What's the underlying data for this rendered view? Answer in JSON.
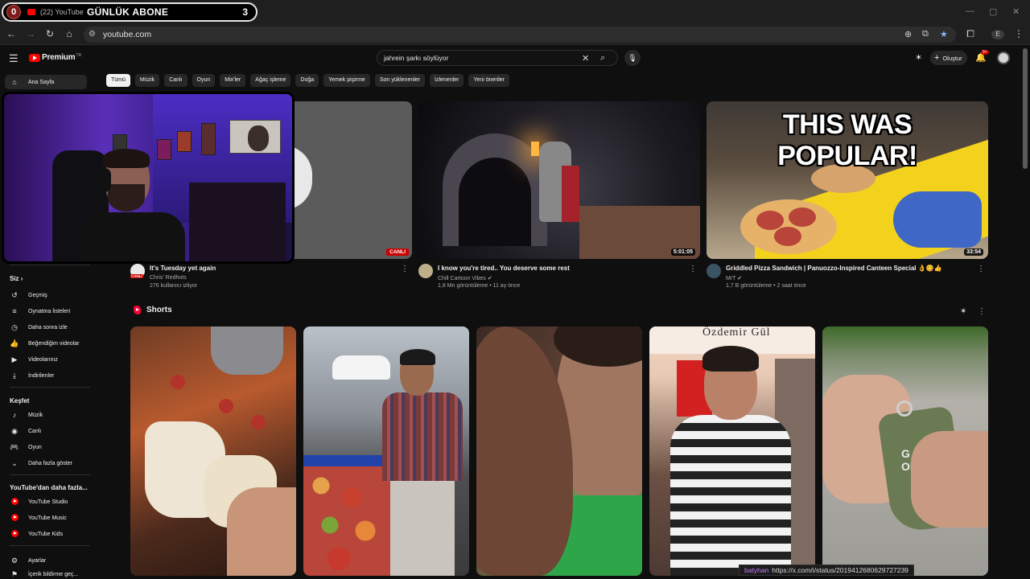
{
  "browser": {
    "tab": {
      "left_count": "0",
      "title": "(22) YouTube",
      "overlay_text": "GÜNLÜK ABONE",
      "right_count": "3"
    },
    "url": "youtube.com"
  },
  "header": {
    "logo_text": "Premium",
    "logo_region": "TR",
    "search_query": "jahrein şarkı söylüyor",
    "create_label": "Oluştur",
    "notifications_badge": "9+"
  },
  "chips": [
    "Tümü",
    "Müzik",
    "Canlı",
    "Oyun",
    "Mix'ler",
    "Ağaç işleme",
    "Doğa",
    "Yemek pişirme",
    "Son yüklenenler",
    "İzlenenler",
    "Yeni öneriler"
  ],
  "sidebar": {
    "home": "Ana Sayfa",
    "you_heading": "Siz",
    "you_items": [
      "Geçmiş",
      "Oynatma listeleri",
      "Daha sonra izle",
      "Beğendiğim videolar",
      "Videolarınız",
      "İndirilenler"
    ],
    "explore_heading": "Keşfet",
    "explore_items": [
      "Müzik",
      "Canlı",
      "Oyun",
      "Daha fazla göster"
    ],
    "more_heading": "YouTube'dan daha fazla...",
    "more_items": [
      "YouTube Studio",
      "YouTube Music",
      "YouTube Kids"
    ],
    "settings": "Ayarlar",
    "history_report": "İçerik bildirme geç..."
  },
  "videos": [
    {
      "title": "It's Tuesday yet again",
      "channel": "Chris' Redhots",
      "stats": "276 kullanıcı izliyor",
      "badge": "CANLI",
      "avatar_badge": "CANLI"
    },
    {
      "title": "I know you're tired.. You deserve some rest",
      "channel": "Chill Cartoon Vibes",
      "stats": "1,8 Mn görüntüleme • 11 ay önce",
      "duration": "5:01:05"
    },
    {
      "title": "Griddled Pizza Sandwich | Panuozzo-Inspired Canteen Special 👌😋👍",
      "channel": "MrT",
      "stats": "1,7 B görüntüleme • 2 saat önce",
      "duration": "33:54",
      "thumbnail_text": "THIS WAS POPULAR!"
    }
  ],
  "shorts": {
    "title": "Shorts",
    "thumb_texts": [
      "Özdemir Gül",
      "G 16 OKE TE"
    ]
  },
  "status_bar": {
    "handle": "batyhan",
    "url": "https://x.com/i/status/2019412680629727239"
  },
  "colors": {
    "background": "#0f0f0f",
    "brand_red": "#ff0000",
    "chip_active": "#f1f1f1",
    "chip_bg": "#272727"
  }
}
